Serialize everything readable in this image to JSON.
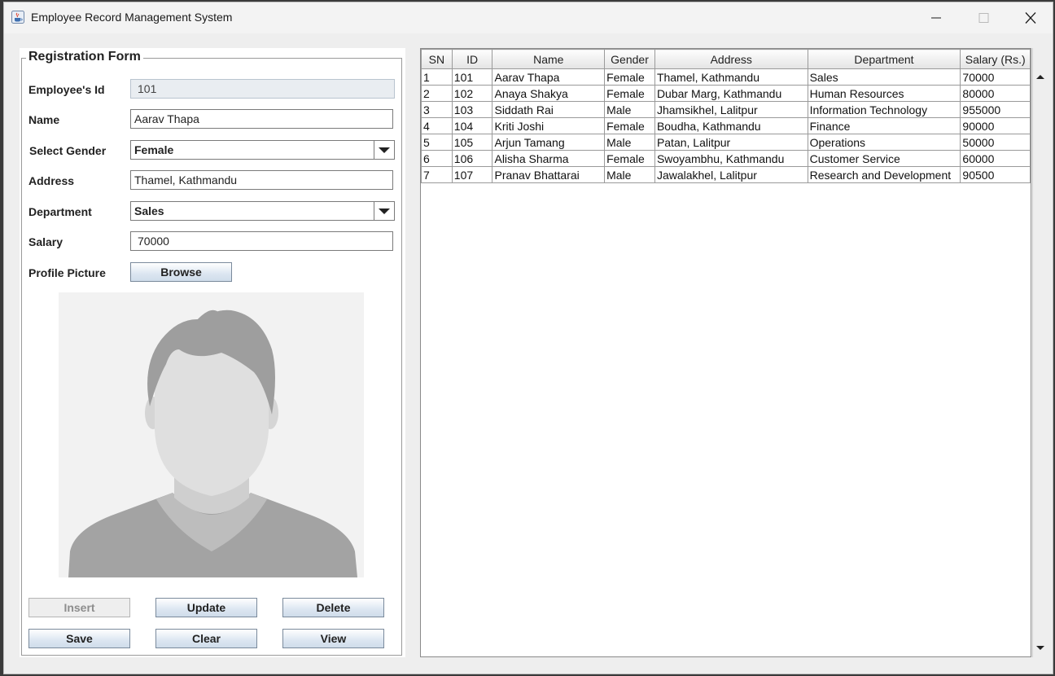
{
  "window": {
    "title": "Employee Record Management System"
  },
  "form": {
    "group_title": "Registration Form",
    "labels": {
      "id": "Employee's Id",
      "name": "Name",
      "gender": "Select Gender",
      "address": "Address",
      "department": "Department",
      "salary": "Salary",
      "picture": "Profile Picture"
    },
    "values": {
      "id": "101",
      "name": "Aarav Thapa",
      "gender": "Female",
      "address": "Thamel, Kathmandu",
      "department": "Sales",
      "salary": "70000"
    },
    "buttons": {
      "browse": "Browse",
      "insert": "Insert",
      "update": "Update",
      "delete": "Delete",
      "save": "Save",
      "clear": "Clear",
      "view": "View"
    }
  },
  "table": {
    "columns": [
      "SN",
      "ID",
      "Name",
      "Gender",
      "Address",
      "Department",
      "Salary (Rs.)"
    ],
    "rows": [
      [
        "1",
        "101",
        "Aarav Thapa",
        "Female",
        "Thamel, Kathmandu",
        "Sales",
        "70000"
      ],
      [
        "2",
        "102",
        "Anaya Shakya",
        "Female",
        "Dubar Marg, Kathmandu",
        "Human Resources",
        "80000"
      ],
      [
        "3",
        "103",
        "Siddath Rai",
        "Male",
        "Jhamsikhel, Lalitpur",
        "Information Technology",
        "955000"
      ],
      [
        "4",
        "104",
        "Kriti Joshi",
        "Female",
        "Boudha, Kathmandu",
        "Finance",
        "90000"
      ],
      [
        "5",
        "105",
        "Arjun Tamang",
        "Male",
        "Patan, Lalitpur",
        "Operations",
        "50000"
      ],
      [
        "6",
        "106",
        "Alisha Sharma",
        "Female",
        "Swoyambhu, Kathmandu",
        "Customer Service",
        "60000"
      ],
      [
        "7",
        "107",
        "Pranav Bhattarai",
        "Male",
        "Jawalakhel, Lalitpur",
        "Research and Development",
        "90500"
      ]
    ]
  },
  "icons": {
    "app": "java-cup-icon",
    "minimize": "minimize-icon",
    "maximize": "maximize-icon",
    "close": "close-icon"
  },
  "colors": {
    "button_gradient_bottom": "#cfdcea",
    "disabled_field": "#e9edf1"
  }
}
